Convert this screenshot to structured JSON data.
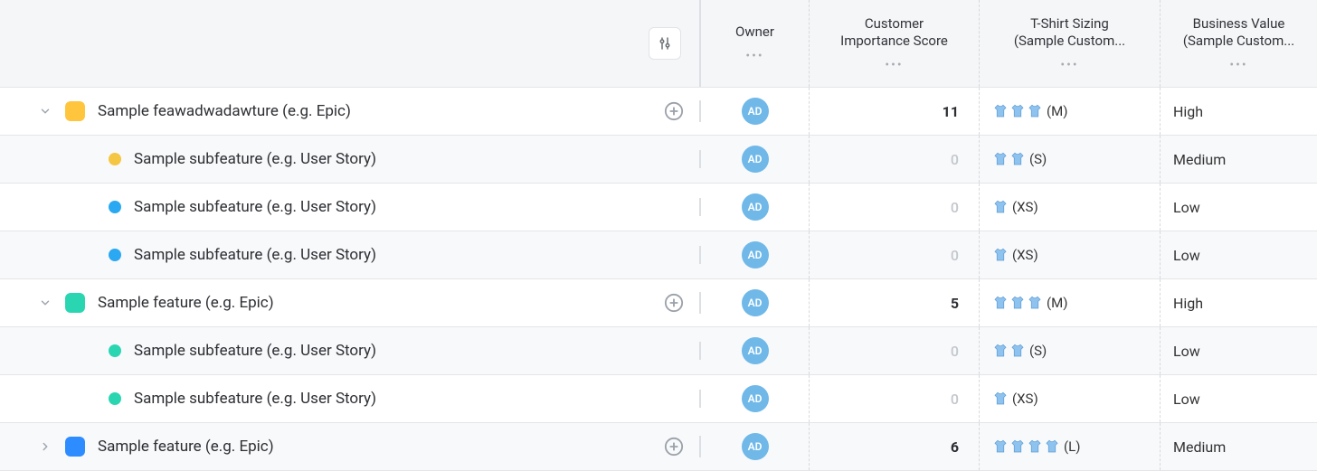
{
  "columns": {
    "owner": "Owner",
    "score_line1": "Customer",
    "score_line2": "Importance Score",
    "tshirt_line1": "T-Shirt Sizing",
    "tshirt_line2": "(Sample Custom...",
    "biz_line1": "Business Value",
    "biz_line2": "(Sample Custom..."
  },
  "owner_initials": "AD",
  "colors": {
    "yellow": "#ffc53d",
    "teal": "#2ad6b2",
    "blue": "#2d8cff",
    "subblue": "#2aa8f2",
    "subyellow": "#f5c642"
  },
  "rows": [
    {
      "kind": "epic",
      "expanded": true,
      "color": "yellow",
      "label": "Sample feawadwadawture (e.g. Epic)",
      "score": "11",
      "score_zero": false,
      "shirts": 3,
      "size": "(M)",
      "biz": "High"
    },
    {
      "kind": "sub",
      "color": "subyellow",
      "label": "Sample subfeature (e.g. User Story)",
      "score": "0",
      "score_zero": true,
      "shirts": 2,
      "size": "(S)",
      "biz": "Medium"
    },
    {
      "kind": "sub",
      "color": "subblue",
      "label": "Sample subfeature (e.g. User Story)",
      "score": "0",
      "score_zero": true,
      "shirts": 1,
      "size": "(XS)",
      "biz": "Low"
    },
    {
      "kind": "sub",
      "color": "subblue",
      "label": "Sample subfeature (e.g. User Story)",
      "score": "0",
      "score_zero": true,
      "shirts": 1,
      "size": "(XS)",
      "biz": "Low"
    },
    {
      "kind": "epic",
      "expanded": true,
      "color": "teal",
      "label": "Sample feature (e.g. Epic)",
      "score": "5",
      "score_zero": false,
      "shirts": 3,
      "size": "(M)",
      "biz": "High"
    },
    {
      "kind": "sub",
      "color": "teal",
      "label": "Sample subfeature (e.g. User Story)",
      "score": "0",
      "score_zero": true,
      "shirts": 2,
      "size": "(S)",
      "biz": "Low"
    },
    {
      "kind": "sub",
      "color": "teal",
      "label": "Sample subfeature (e.g. User Story)",
      "score": "0",
      "score_zero": true,
      "shirts": 1,
      "size": "(XS)",
      "biz": "Low"
    },
    {
      "kind": "epic",
      "expanded": false,
      "color": "blue",
      "label": "Sample feature (e.g. Epic)",
      "score": "6",
      "score_zero": false,
      "shirts": 4,
      "size": "(L)",
      "biz": "Medium"
    }
  ]
}
